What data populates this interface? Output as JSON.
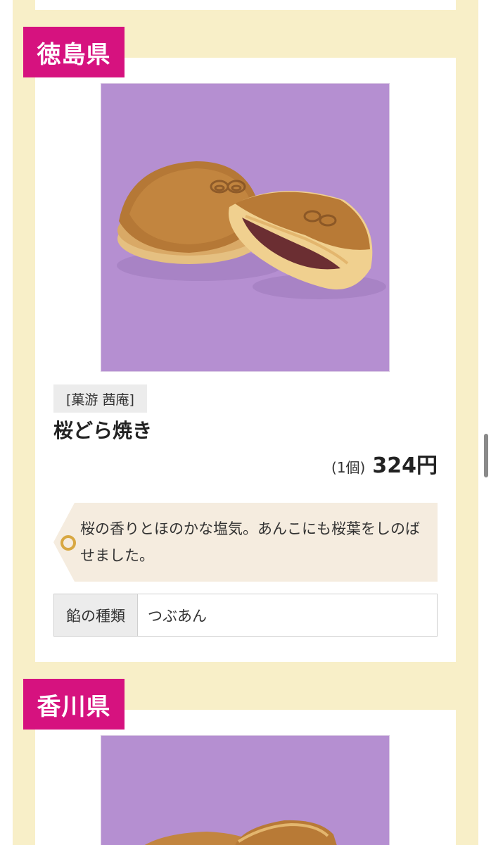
{
  "sections": [
    {
      "prefecture": "徳島県",
      "shop": "[菓游 茜庵]",
      "product_name": "桜どら焼き",
      "price_unit": "(1個)",
      "price": "324円",
      "description": "桜の香りとほのかな塩気。あんこにも桜葉をしのばせました。",
      "filling_label": "餡の種類",
      "filling_value": "つぶあん"
    },
    {
      "prefecture": "香川県"
    }
  ],
  "colors": {
    "page_background": "#f8efc8",
    "prefecture_label": "#d6127f",
    "photo_background": "#b58fd1",
    "description_background": "#f5ecdf"
  }
}
